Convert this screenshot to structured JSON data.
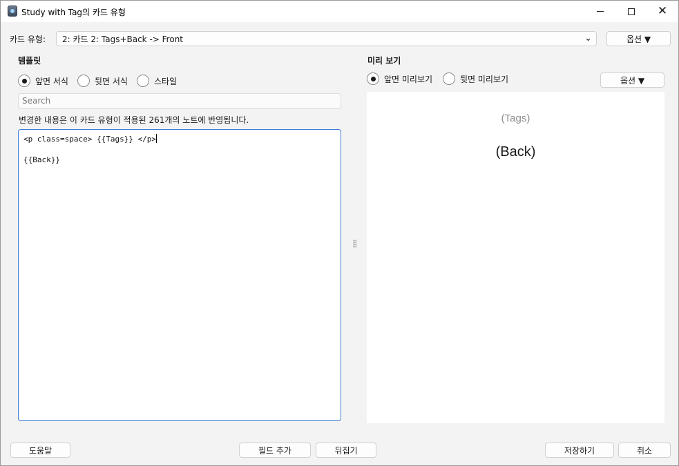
{
  "window": {
    "title": "Study with Tag의 카드 유형",
    "minimize_icon": "minimize-icon",
    "maximize_icon": "maximize-icon",
    "close_icon": "close-icon"
  },
  "card_type": {
    "label": "카드 유형:",
    "selected": "2: 카드 2: Tags+Back -> Front",
    "options_button": "옵션 ▼"
  },
  "template": {
    "heading": "템플릿",
    "radios": [
      {
        "label": "앞면 서식",
        "selected": true
      },
      {
        "label": "뒷면 서식",
        "selected": false
      },
      {
        "label": "스타일",
        "selected": false
      }
    ],
    "search_placeholder": "Search",
    "notice": "변경한 내용은 이 카드 유형이 적용된 261개의 노트에 반영됩니다.",
    "editor_lines": [
      "<p class=space> {{Tags}} </p>",
      "",
      "{{Back}}"
    ]
  },
  "preview": {
    "heading": "미리 보기",
    "radios": [
      {
        "label": "앞면 미리보기",
        "selected": true
      },
      {
        "label": "뒷면 미리보기",
        "selected": false
      }
    ],
    "options_button": "옵션 ▼",
    "tags_text": "(Tags)",
    "back_text": "(Back)"
  },
  "footer": {
    "help": "도움말",
    "add_field": "필드 추가",
    "flip": "뒤집기",
    "save": "저장하기",
    "cancel": "취소"
  },
  "colors": {
    "editor_focus_border": "#3a7bd5",
    "tags_preview": "#8c8c8c"
  }
}
